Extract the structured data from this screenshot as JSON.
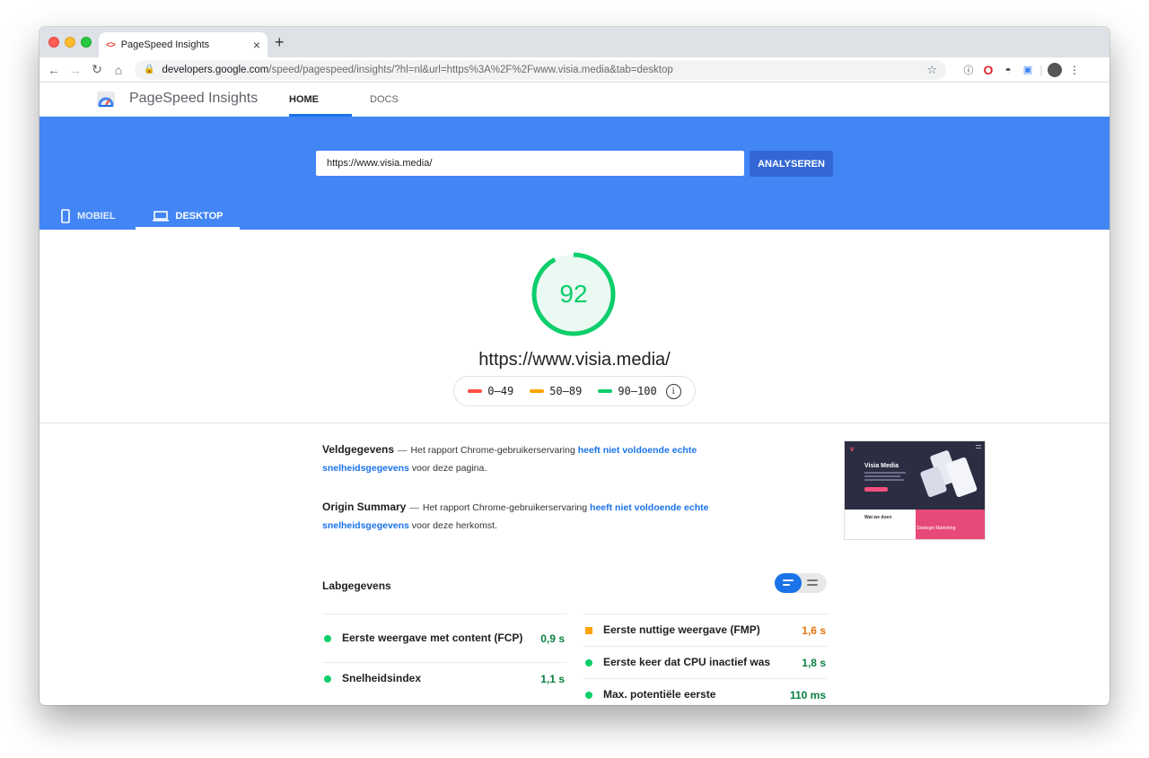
{
  "browser": {
    "tab_title": "PageSpeed Insights",
    "tab_close": "×",
    "new_tab": "+",
    "url_host": "developers.google.com",
    "url_path": "/speed/pagespeed/insights/?hl=nl&url=https%3A%2F%2Fwww.visia.media&tab=desktop"
  },
  "header": {
    "brand": "PageSpeed Insights",
    "nav_home": "HOME",
    "nav_docs": "DOCS"
  },
  "search": {
    "url_value": "https://www.visia.media/",
    "analyze_label": "ANALYSEREN"
  },
  "device_tabs": {
    "mobile": "MOBIEL",
    "desktop": "DESKTOP",
    "selected": "desktop"
  },
  "score": {
    "value": "92",
    "fraction": 0.92,
    "color": "#0cce6b",
    "url": "https://www.visia.media/"
  },
  "legend": {
    "bad": "0–49",
    "average": "50–89",
    "good": "90–100",
    "colors": {
      "bad": "#ff4e42",
      "average": "#ffa400",
      "good": "#0cce6b"
    }
  },
  "field_data": {
    "title": "Veldgegevens",
    "text_before": "Het rapport Chrome-gebruikerservaring",
    "link": "heeft niet voldoende echte snelheidsgegevens",
    "text_after": "voor deze pagina."
  },
  "origin_summary": {
    "title": "Origin Summary",
    "text_before": "Het rapport Chrome-gebruikerservaring",
    "link": "heeft niet voldoende echte snelheidsgegevens",
    "text_after": "voor deze herkomst."
  },
  "thumbnail": {
    "heading": "Visia Media",
    "section": "Wat we doen",
    "section2": "Strategie Marketing"
  },
  "lab": {
    "title": "Labgegevens",
    "metrics_left": [
      {
        "name": "Eerste weergave met content (FCP)",
        "value": "0,9 s",
        "status": "good"
      },
      {
        "name": "Snelheidsindex",
        "value": "1,1 s",
        "status": "good"
      }
    ],
    "metrics_right": [
      {
        "name": "Eerste nuttige weergave (FMP)",
        "value": "1,6 s",
        "status": "average"
      },
      {
        "name": "Eerste keer dat CPU inactief was",
        "value": "1,8 s",
        "status": "good"
      },
      {
        "name": "Max. potentiële eerste",
        "value": "110 ms",
        "status": "good"
      }
    ]
  }
}
